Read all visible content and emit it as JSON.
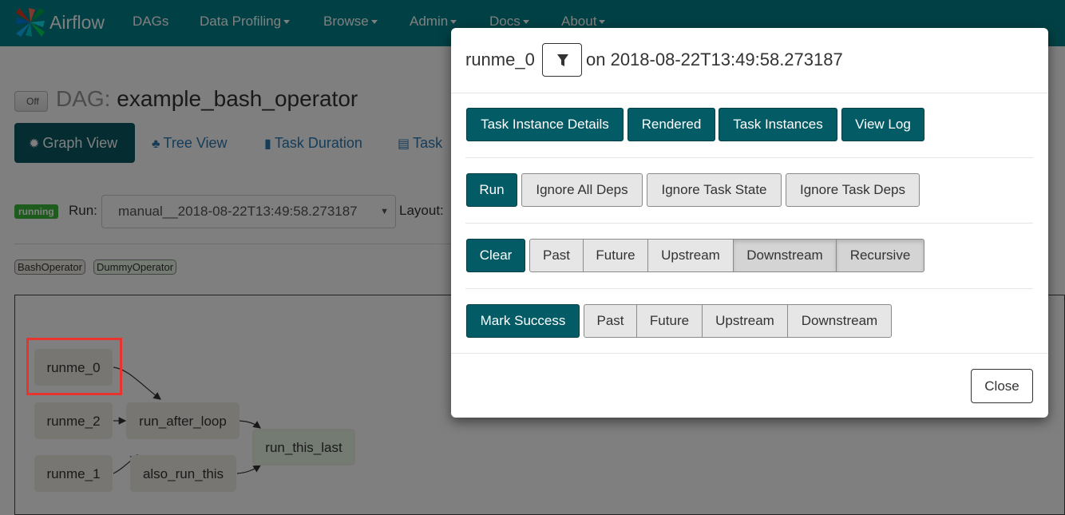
{
  "navbar": {
    "brand": "Airflow",
    "items": [
      {
        "label": "DAGs",
        "dropdown": false
      },
      {
        "label": "Data Profiling",
        "dropdown": true
      },
      {
        "label": "Browse",
        "dropdown": true
      },
      {
        "label": "Admin",
        "dropdown": true
      },
      {
        "label": "Docs",
        "dropdown": true
      },
      {
        "label": "About",
        "dropdown": true
      }
    ]
  },
  "dag": {
    "toggle_label": "Off",
    "title_prefix": "DAG:",
    "title": "example_bash_operator"
  },
  "tabs": [
    {
      "label": "Graph View",
      "icon": "gear-icon",
      "active": true
    },
    {
      "label": "Tree View",
      "icon": "tree-icon",
      "active": false
    },
    {
      "label": "Task Duration",
      "icon": "bar-chart-icon",
      "active": false
    },
    {
      "label": "Task",
      "icon": "file-icon",
      "active": false
    }
  ],
  "run_bar": {
    "state_badge": "running",
    "run_label": "Run:",
    "run_value": "manual__2018-08-22T13:49:58.273187",
    "layout_label": "Layout:"
  },
  "legend": [
    "BashOperator",
    "DummyOperator"
  ],
  "graph": {
    "nodes": [
      "runme_0",
      "runme_2",
      "run_after_loop",
      "runme_1",
      "also_run_this",
      "run_this_last"
    ]
  },
  "modal": {
    "task_id": "runme_0",
    "on_text": "on 2018-08-22T13:49:58.273187",
    "filter_icon": "filter-icon",
    "nav_buttons": [
      "Task Instance Details",
      "Rendered",
      "Task Instances",
      "View Log"
    ],
    "run": {
      "button": "Run",
      "options": [
        "Ignore All Deps",
        "Ignore Task State",
        "Ignore Task Deps"
      ]
    },
    "clear": {
      "button": "Clear",
      "options": [
        "Past",
        "Future",
        "Upstream",
        "Downstream",
        "Recursive"
      ]
    },
    "mark_success": {
      "button": "Mark Success",
      "options": [
        "Past",
        "Future",
        "Upstream",
        "Downstream"
      ]
    },
    "close_label": "Close"
  },
  "colors": {
    "navbar": "#03828b",
    "primary_button": "#035b66",
    "running_badge": "#3ab93a",
    "highlight_border": "#e8342f"
  }
}
